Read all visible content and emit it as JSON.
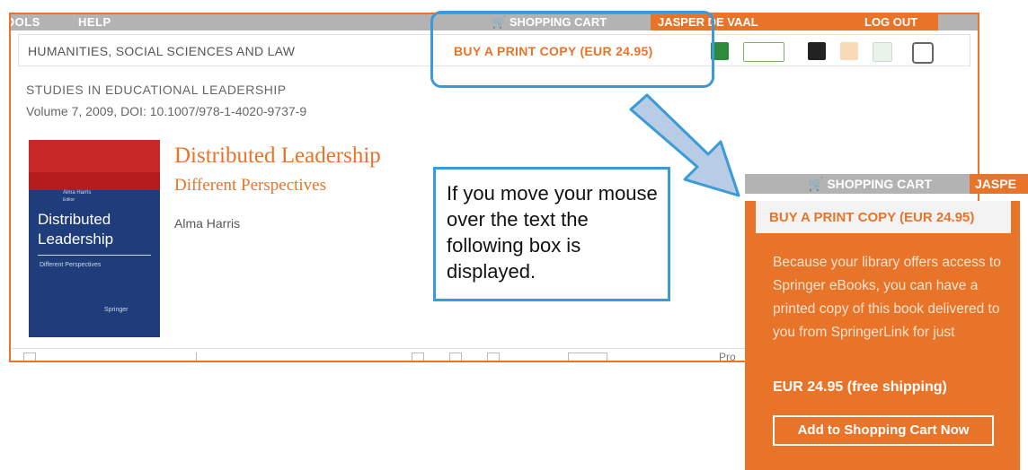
{
  "topnav": {
    "tools": "OOLS",
    "help": "HELP",
    "cart": "SHOPPING CART",
    "user": "JASPER DE VAAL",
    "logout": "LOG OUT"
  },
  "breadcrumb": {
    "subject": "HUMANITIES, SOCIAL SCIENCES AND LAW",
    "buy_print": "BUY A PRINT COPY (EUR 24.95)"
  },
  "toolbar_icons": [
    "share-icon",
    "reader-icon",
    "save-icon",
    "rss-icon",
    "export-icon",
    "print-icon"
  ],
  "book": {
    "series": "STUDIES IN EDUCATIONAL LEADERSHIP",
    "volume": "Volume 7, 2009, DOI: 10.1007/978-1-4020-9737-9",
    "title": "Distributed Leadership",
    "subtitle": "Different Perspectives",
    "author": "Alma Harris",
    "cover": {
      "title": "Distributed Leadership",
      "editor": "Alma Harris",
      "editor_role": "Editor",
      "tag": "Different Perspectives",
      "publisher": "Springer"
    }
  },
  "bottombar": {
    "pro": "Pro"
  },
  "callout": {
    "text": "If you move your mouse over the text the following box is displayed."
  },
  "popup": {
    "cart": "SHOPPING CART",
    "user": "JASPE",
    "buy_print": "BUY A PRINT COPY (EUR 24.95)",
    "description": "Because your library offers access to Springer eBooks, you can have a printed copy of this book delivered to you from SpringerLink for just",
    "price": "EUR 24.95 (free shipping)",
    "add_button": "Add to Shopping Cart Now"
  },
  "colors": {
    "accent": "#e8742a",
    "nav_gray": "#b3b3b3",
    "annotation_blue": "#3a9bd8",
    "cover_blue": "#1f3d7a",
    "cover_red": "#c62828"
  }
}
